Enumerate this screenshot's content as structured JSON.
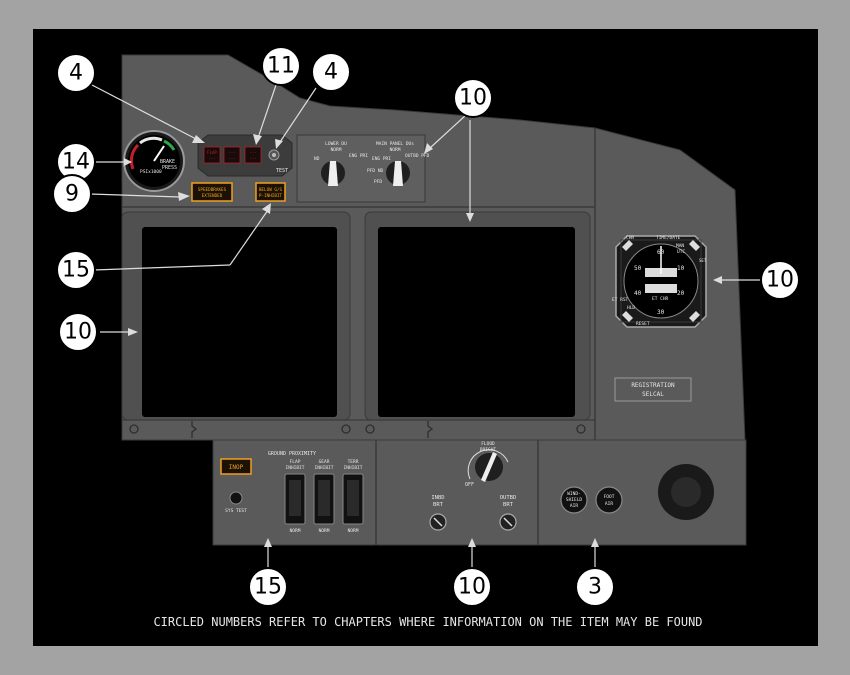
{
  "colors": {
    "frame": "#a3a3a3",
    "background": "#000000",
    "panel": "#5a5a5a",
    "panel_light": "#6a6a6a",
    "amber": "#f0a020",
    "annunciator_red": "#c0202a"
  },
  "callouts": [
    {
      "id": "c14",
      "number": "14"
    },
    {
      "id": "c4a",
      "number": "4"
    },
    {
      "id": "c11",
      "number": "11"
    },
    {
      "id": "c4b",
      "number": "4"
    },
    {
      "id": "c10a",
      "number": "10"
    },
    {
      "id": "c9",
      "number": "9"
    },
    {
      "id": "c15a",
      "number": "15"
    },
    {
      "id": "c10b",
      "number": "10"
    },
    {
      "id": "c10c",
      "number": "10"
    },
    {
      "id": "c15b",
      "number": "15"
    },
    {
      "id": "c10d",
      "number": "10"
    },
    {
      "id": "c3",
      "number": "3"
    }
  ],
  "brake_gauge": {
    "label_1": "BRAKE",
    "label_2": "PRESS",
    "units": "PSIx1000"
  },
  "annunciators": [
    {
      "line1": "FLAP",
      "line2": "---"
    },
    {
      "line1": "---",
      "line2": "---"
    },
    {
      "line1": "---",
      "line2": "---"
    }
  ],
  "test_label": "TEST",
  "speedbrakes": {
    "line1": "SPEEDBRAKES",
    "line2": "EXTENDED"
  },
  "below_gs": {
    "line1": "BELOW G/S",
    "line2": "P-INHIBIT"
  },
  "lower_du": {
    "title": "LOWER DU",
    "norm": "NORM",
    "left": "ND",
    "right": "ENG PRI"
  },
  "main_panel_dus": {
    "title": "MAIN PANEL DUs",
    "norm": "NORM",
    "left": "ENG PRI",
    "right": "OUTBD PFD",
    "lower_left": "PFD ND",
    "lower": "PFD"
  },
  "clock": {
    "chr": "CHR",
    "time_date": "TIME/DATE",
    "man": "MAN",
    "utc": "UTC",
    "set": "SET",
    "et_rst": "ET RST",
    "et_chr": "ET CHR",
    "hld": "HLD",
    "reset": "RESET",
    "n60": "60",
    "n10": "10",
    "n20": "20",
    "n30": "30",
    "n40": "40",
    "n50": "50"
  },
  "registration": {
    "line1": "REGISTRATION",
    "line2": "SELCAL"
  },
  "gpws": {
    "title": "GROUND PROXIMITY",
    "inop": "INOP",
    "sys_test": "SYS TEST",
    "switches": [
      {
        "top1": "FLAP",
        "top2": "INHIBIT",
        "bottom": "NORM"
      },
      {
        "top1": "GEAR",
        "top2": "INHIBIT",
        "bottom": "NORM"
      },
      {
        "top1": "TERR",
        "top2": "INHIBIT",
        "bottom": "NORM"
      }
    ]
  },
  "brightness": {
    "main_label_1": "FLOOD",
    "main_label_2": "BRIGHT",
    "off": "OFF",
    "inbd_1": "INBD",
    "inbd_2": "BRT",
    "outbd_1": "OUTBD",
    "outbd_2": "BRT"
  },
  "air_buttons": [
    {
      "line1": "WIND-",
      "line2": "SHIELD",
      "line3": "AIR"
    },
    {
      "line1": "FOOT",
      "line2": "AIR"
    }
  ],
  "footer": "CIRCLED NUMBERS REFER TO CHAPTERS WHERE INFORMATION ON THE ITEM MAY BE FOUND"
}
